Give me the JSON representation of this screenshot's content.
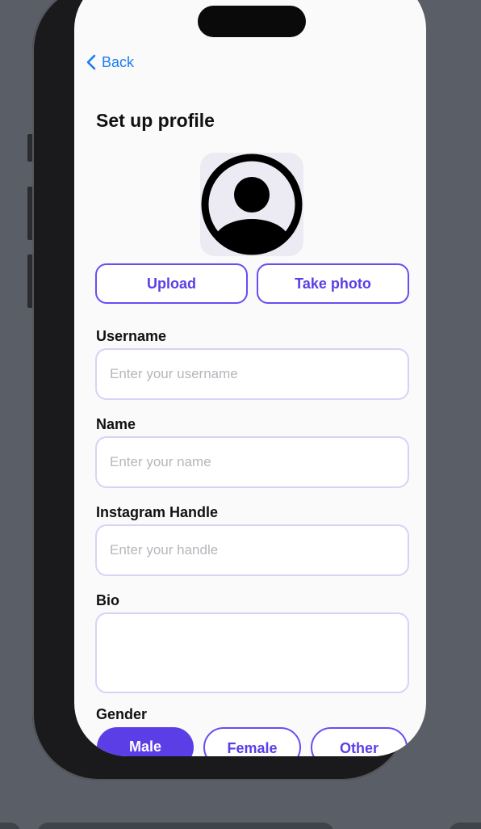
{
  "nav": {
    "back_label": "Back"
  },
  "page": {
    "title": "Set up profile"
  },
  "photo_actions": {
    "upload_label": "Upload",
    "take_photo_label": "Take photo"
  },
  "fields": {
    "username": {
      "label": "Username",
      "placeholder": "Enter your username",
      "value": ""
    },
    "name": {
      "label": "Name",
      "placeholder": "Enter your name",
      "value": ""
    },
    "instagram": {
      "label": "Instagram Handle",
      "placeholder": "Enter your handle",
      "value": ""
    },
    "bio": {
      "label": "Bio",
      "value": ""
    }
  },
  "gender": {
    "label": "Gender",
    "options": [
      "Male",
      "Female",
      "Other"
    ],
    "selected": "Male"
  },
  "icons": {
    "back": "chevron-left-icon",
    "avatar": "person-circle-icon"
  },
  "colors": {
    "accent": "#5b3ee6",
    "link": "#1a7cf2",
    "field_border": "#d8d2f6"
  }
}
